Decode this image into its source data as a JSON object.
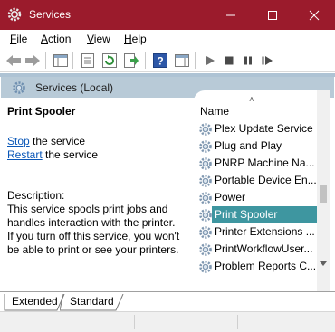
{
  "window": {
    "title": "Services"
  },
  "menu": {
    "items": [
      {
        "label": "File"
      },
      {
        "label": "Action"
      },
      {
        "label": "View"
      },
      {
        "label": "Help"
      }
    ]
  },
  "panel": {
    "header": "Services (Local)"
  },
  "details": {
    "service_name": "Print Spooler",
    "stop_link": "Stop",
    "stop_rest": " the service",
    "restart_link": "Restart",
    "restart_rest": " the service",
    "description_label": "Description:",
    "description_lines": [
      "This service spools print jobs and",
      "handles interaction with the printer.",
      "If you turn off this service, you won't",
      "be able to print or see your printers."
    ]
  },
  "list": {
    "column_header": "Name",
    "rows": [
      "Plex Update Service",
      "Plug and Play",
      "PNRP Machine Na...",
      "Portable Device En...",
      "Power",
      "Print Spooler",
      "Printer Extensions ...",
      "PrintWorkflowUser...",
      "Problem Reports C..."
    ],
    "selected_index": 5
  },
  "tabs": [
    {
      "label": "Extended"
    },
    {
      "label": "Standard"
    }
  ],
  "colors": {
    "titlebar": "#9b1b2c",
    "selection": "#3e96a0",
    "link": "#0a57b8",
    "panel_header": "#b8cad7"
  }
}
